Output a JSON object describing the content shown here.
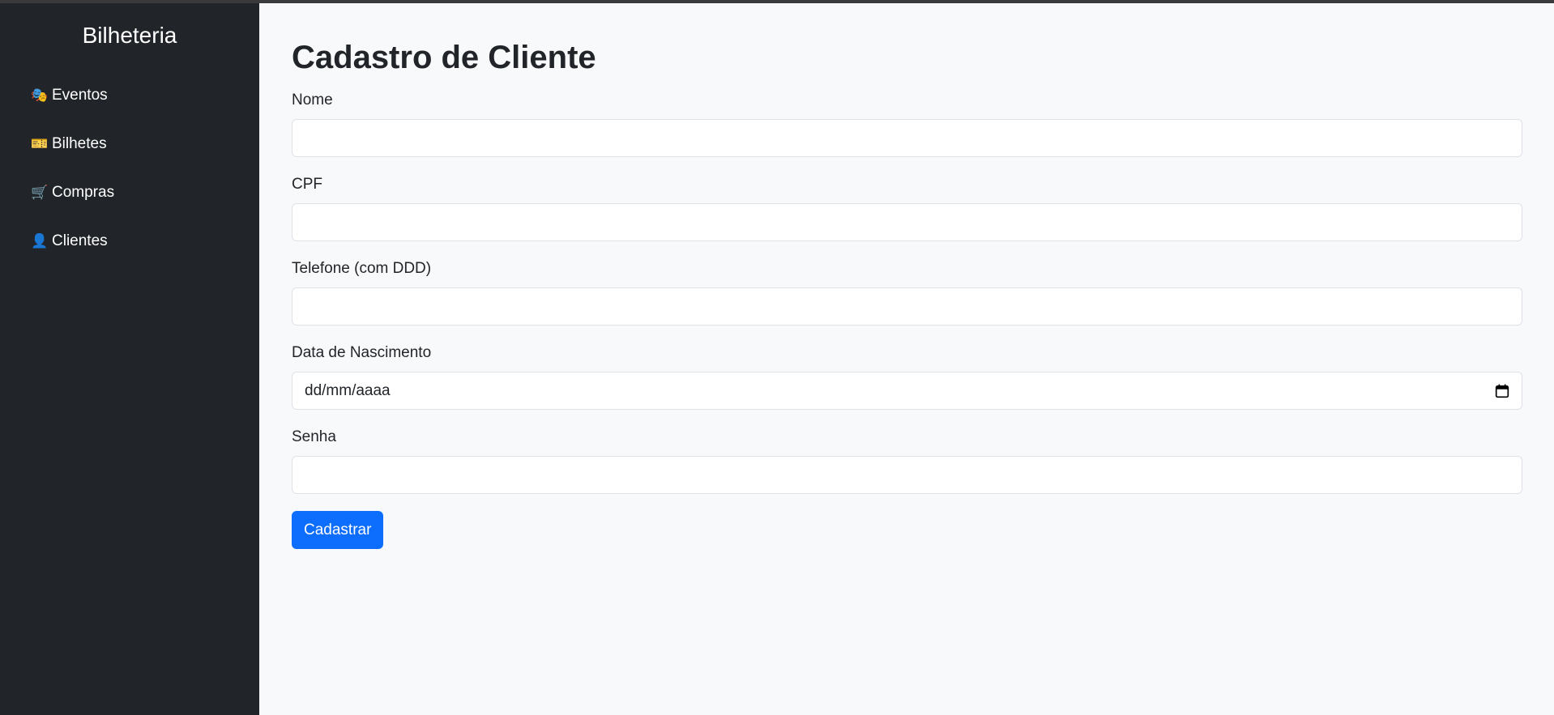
{
  "sidebar": {
    "brand": "Bilheteria",
    "items": [
      {
        "icon": "theater-masks-icon",
        "glyph": "🎭",
        "label": "Eventos"
      },
      {
        "icon": "ticket-icon",
        "glyph": "🎫",
        "label": "Bilhetes"
      },
      {
        "icon": "cart-icon",
        "glyph": "🛒",
        "label": "Compras"
      },
      {
        "icon": "user-icon",
        "glyph": "👤",
        "label": "Clientes"
      }
    ]
  },
  "main": {
    "title": "Cadastro de Cliente",
    "fields": {
      "nome": {
        "label": "Nome",
        "value": ""
      },
      "cpf": {
        "label": "CPF",
        "value": ""
      },
      "telefone": {
        "label": "Telefone (com DDD)",
        "value": ""
      },
      "nascimento": {
        "label": "Data de Nascimento",
        "placeholder": "dd/mm/aaaa"
      },
      "senha": {
        "label": "Senha",
        "value": ""
      }
    },
    "submit_label": "Cadastrar"
  },
  "colors": {
    "sidebar_bg": "#212529",
    "main_bg": "#f8f9fa",
    "primary": "#0d6efd"
  }
}
